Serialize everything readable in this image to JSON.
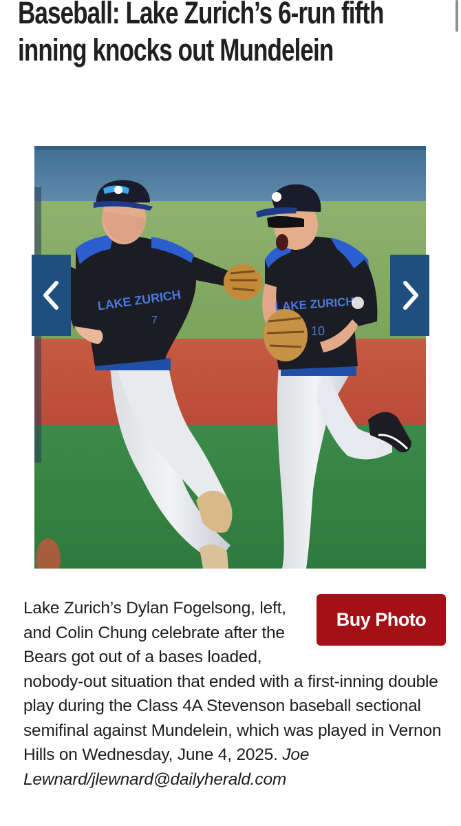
{
  "article": {
    "headline": "Baseball: Lake Zurich’s 6-run fifth inning knocks out Mundelein"
  },
  "gallery": {
    "prev_icon": "chevron-left-icon",
    "next_icon": "chevron-right-icon",
    "jersey_text_left": "LAKE ZURICH",
    "jersey_text_right": "LAKE ZURICH",
    "accent_color": "#1f4f7e"
  },
  "caption": {
    "text": "Lake Zurich’s Dylan Fogelsong, left, and Colin Chung celebrate after the Bears got out of a bases loaded, nobody-out situation that ended with a first-inning double play during the Class 4A Stevenson baseball sectional semifinal against Mundelein, which was played in Vernon Hills on Wednesday, June 4, 2025.",
    "credit": "Joe Lewnard/jlewnard@dailyherald.com"
  },
  "buy_photo": {
    "label": "Buy Photo",
    "color": "#a50f16"
  }
}
